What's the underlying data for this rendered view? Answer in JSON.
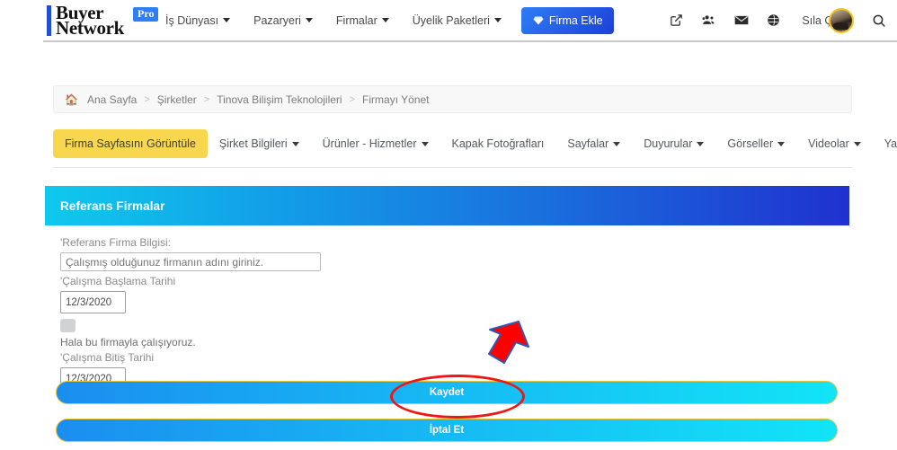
{
  "navbar": {
    "brand": {
      "line1": "Buyer",
      "line2": "Network",
      "badge": "Pro"
    },
    "links": [
      {
        "label": "İş Dünyası",
        "caret": true
      },
      {
        "label": "Pazaryeri",
        "caret": true
      },
      {
        "label": "Firmalar",
        "caret": true
      },
      {
        "label": "Üyelik Paketleri",
        "caret": true
      }
    ],
    "cta": {
      "label": "Firma Ekle",
      "icon": "diamond-icon"
    },
    "right_icons": [
      "external-link-icon",
      "users-group-icon",
      "envelope-icon",
      "globe-icon"
    ],
    "user": {
      "name": "Sıla Çil",
      "avatar": "user-avatar"
    },
    "search_icon": "search-icon"
  },
  "breadcrumb": {
    "home_icon": "home-icon",
    "items": [
      "Ana Sayfa",
      "Şirketler",
      "Tinova Bilişim Teknolojileri",
      "Firmayı Yönet"
    ],
    "separator": ">"
  },
  "tabs": {
    "primary": {
      "label": "Firma Sayfasını Görüntüle"
    },
    "items": [
      {
        "label": "Şirket Bilgileri",
        "caret": true
      },
      {
        "label": "Ürünler - Hizmetler",
        "caret": true
      },
      {
        "label": "Kapak Fotoğrafları",
        "caret": false
      },
      {
        "label": "Sayfalar",
        "caret": true
      },
      {
        "label": "Duyurular",
        "caret": true
      },
      {
        "label": "Görseller",
        "caret": true
      },
      {
        "label": "Videolar",
        "caret": true
      },
      {
        "label": "Yardım",
        "caret": true
      }
    ]
  },
  "panel": {
    "title": "Referans Firmalar",
    "fields": {
      "company_label": "'Referans Firma Bilgisi:",
      "company_placeholder": "Çalışmış olduğunuz firmanın adını giriniz.",
      "company_value": "",
      "start_label": "'Çalışma Başlama Tarihi",
      "start_value": "12/3/2020",
      "still_working_label": "Hala bu firmayla çalışıyoruz.",
      "end_label": "'Çalışma Bitiş Tarihi",
      "end_value": "12/3/2020"
    },
    "actions": {
      "save_label": "Kaydet",
      "cancel_label": "İptal Et"
    }
  },
  "annotations": {
    "ellipse_target": "Kaydet",
    "arrow_color": "#ff0000",
    "ellipse_color": "#ef1616"
  },
  "colors": {
    "panel_header_start": "#0fc9ec",
    "panel_header_end": "#1f31cf",
    "accent_yellow": "#f8d64e",
    "button_gradient_start": "#1a8ef0",
    "button_gradient_end": "#12e4f7",
    "cta_blue": "#2f7ef5"
  }
}
